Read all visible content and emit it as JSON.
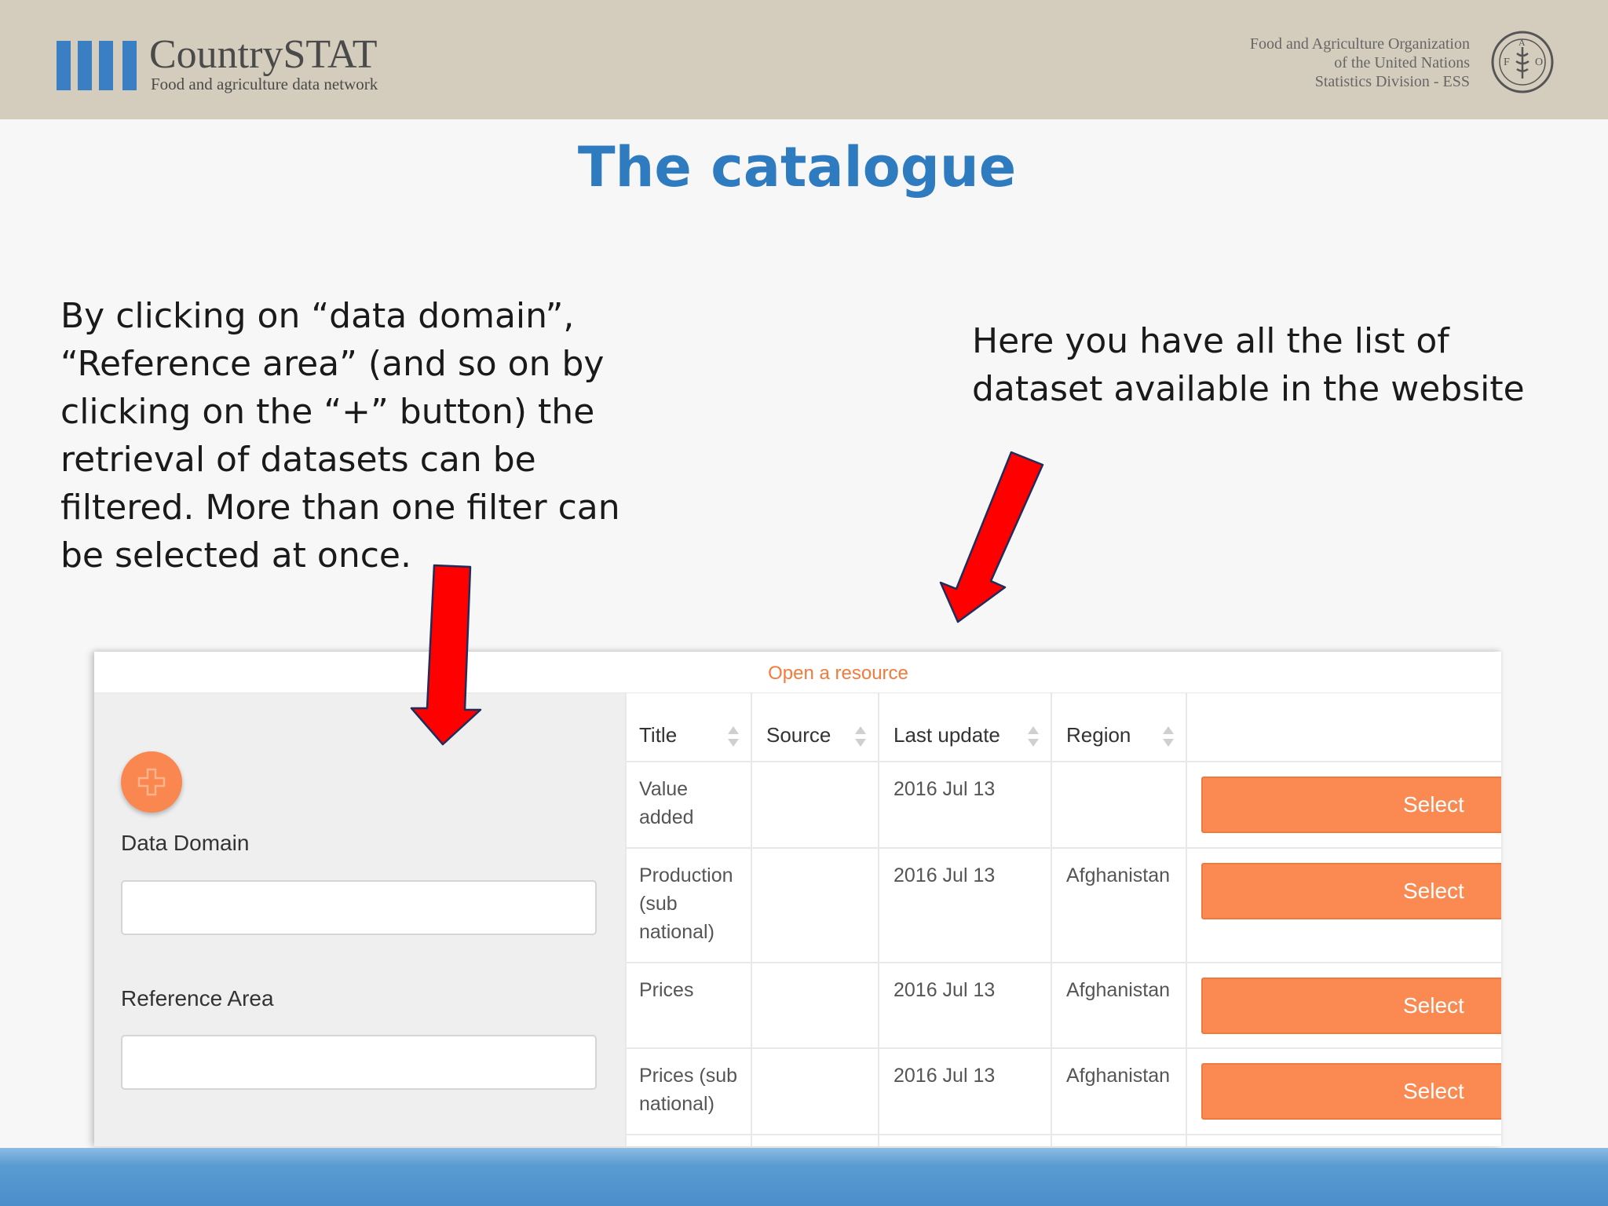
{
  "header": {
    "brand_name": "CountrySTAT",
    "brand_tagline": "Food and agriculture data network",
    "org_line1": "Food and Agriculture Organization",
    "org_line2": "of the United Nations",
    "org_line3": "Statistics Division - ESS",
    "emblem_icon": "fao-emblem-icon"
  },
  "slide": {
    "title": "The catalogue",
    "left_text": "By clicking on “data domain”, “Reference area”  (and so on by clicking on the “+” button) the retrieval of datasets can be filtered. More than one filter can be selected at once.",
    "right_text": "Here you have all the list of dataset available in the website",
    "arrow_color": "#ff0000"
  },
  "catalogue": {
    "header_text": "Open a resource",
    "accent_color": "#fa8a52",
    "add_button_icon": "plus-icon",
    "filters": {
      "data_domain_label": "Data Domain",
      "data_domain_value": "",
      "reference_area_label": "Reference Area",
      "reference_area_value": ""
    },
    "columns": [
      "Title",
      "Source",
      "Last update",
      "Region"
    ],
    "rows": [
      {
        "title": "Value added",
        "source": "",
        "last_update": "2016 Jul 13",
        "region": "",
        "action": "Select"
      },
      {
        "title": "Production (sub national)",
        "source": "",
        "last_update": "2016 Jul 13",
        "region": "Afghanistan",
        "action": "Select"
      },
      {
        "title": "Prices",
        "source": "",
        "last_update": "2016 Jul 13",
        "region": "Afghanistan",
        "action": "Select"
      },
      {
        "title": "Prices (sub national)",
        "source": "",
        "last_update": "2016 Jul 13",
        "region": "Afghanistan",
        "action": "Select"
      }
    ]
  }
}
